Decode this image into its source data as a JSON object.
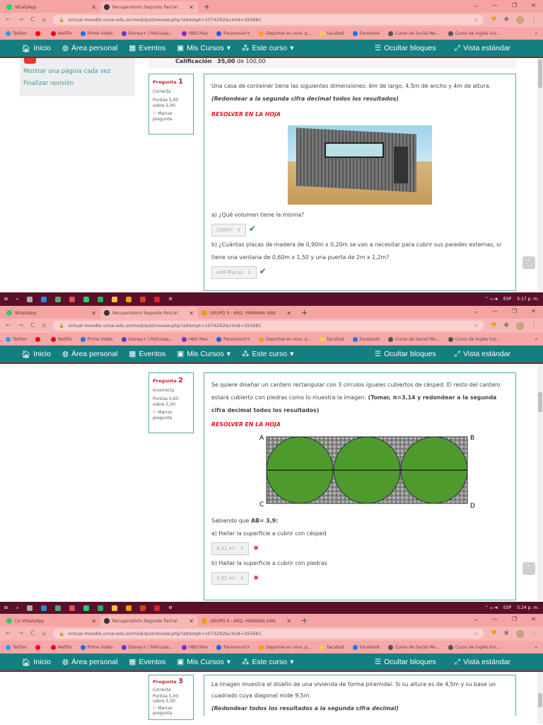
{
  "windows": [
    {
      "tabs": [
        {
          "label": "WhatsApp",
          "icon": "whatsapp-icon",
          "color": "#25d366"
        },
        {
          "label": "Recuperatorio Segundo Parcial",
          "icon": "moodle-icon",
          "color": "#333333"
        }
      ],
      "url": "virtual-moodle.unne.edu.ar/mod/quiz/review.php?attempt=1074292&cmid=355681"
    },
    {
      "tabs": [
        {
          "label": "WhatsApp",
          "icon": "whatsapp-icon",
          "color": "#25d366"
        },
        {
          "label": "Recuperatorio Segundo Parcial",
          "icon": "moodle-icon",
          "color": "#333333"
        },
        {
          "label": "GRUPO 9 - ARQ. MARIANA SÁN",
          "icon": "group-icon",
          "color": "#e0a020"
        }
      ],
      "url": "virtual-moodle.unne.edu.ar/mod/quiz/review.php?attempt=1074292&cmid=355681"
    },
    {
      "tabs": [
        {
          "label": "(1) WhatsApp",
          "icon": "whatsapp-icon",
          "color": "#25d366"
        },
        {
          "label": "Recuperatorio Segundo Parcial",
          "icon": "moodle-icon",
          "color": "#333333"
        },
        {
          "label": "GRUPO 9 - ARQ. MARIANA SÁN",
          "icon": "group-icon",
          "color": "#e0a020"
        }
      ],
      "url": "virtual-moodle.unne.edu.ar/mod/quiz/review.php?attempt=1074292&cmid=355681"
    }
  ],
  "bookmarks": [
    {
      "label": "Twitter",
      "color": "#1da1f2"
    },
    {
      "label": "",
      "color": "#ff0000"
    },
    {
      "label": "Netflix",
      "color": "#e50914"
    },
    {
      "label": "Prime Video",
      "color": "#1a73e8"
    },
    {
      "label": "Disney+ | Películas...",
      "color": "#5a3fd0"
    },
    {
      "label": "HBO Max",
      "color": "#7b2fd0"
    },
    {
      "label": "Paramount+",
      "color": "#0064ff"
    },
    {
      "label": "Deportes en vivo, p...",
      "color": "#ff9900"
    },
    {
      "label": "facultad",
      "color": "#f7d046"
    },
    {
      "label": "Facebook",
      "color": "#1877f2"
    },
    {
      "label": "Curso de Social Me...",
      "color": "#555555"
    },
    {
      "label": "Curso de Inglés Inic...",
      "color": "#555555"
    }
  ],
  "nav": {
    "inicio": "Inicio",
    "area": "Área personal",
    "eventos": "Eventos",
    "mis_cursos": "Mis Cursos",
    "este_curso": "Este curso",
    "ocultar": "Ocultar bloques",
    "vista": "Vista estándar"
  },
  "taskbar": [
    {
      "lang": "ESP",
      "time": "5:17 p. m."
    },
    {
      "lang": "ESP",
      "time": "5:24 p. m."
    }
  ],
  "sidebar": {
    "mostrar": "Mostrar una página cada vez",
    "finalizar": "Finalizar revisión"
  },
  "summary": {
    "label": "Calificación",
    "value": "35,00",
    "of": "de 100,00"
  },
  "questions": [
    {
      "title": "Pregunta",
      "number": "1",
      "status": "Correcta",
      "score": "Puntúa 5,00 sobre 5,00",
      "flag": "Marcar pregunta",
      "text": "Una casa de conteiner tiene las siguientes dimensiones: 6m de largo, 4,5m de ancho y 4m de altura.",
      "note": "(Redondear a la segunda cifra decimal todos los resultados)",
      "resolver": "RESOLVER EN LA HOJA",
      "parts": [
        {
          "q": "a) ¿Qué volumen tiene la misma?",
          "answer": "108m³",
          "correct": true
        },
        {
          "q": "b) ¿Cuántas placas de madera de 0,90m x 0,20m se van a necesitar para cubrir sus paredes externas, si tiene una  ventana  de 0,60m x 1,50 y una puerta de 2m x 1,2m?",
          "answer": "449 Placas",
          "correct": true
        }
      ]
    },
    {
      "title": "Pregunta",
      "number": "2",
      "status": "Incorrecta",
      "score": "Puntúa 0,00 sobre 5,00",
      "flag": "Marcar pregunta",
      "text": "Se quiere diseñar un cantero rectangular con 3  círculos iguales cubiertos de césped.  El resto del cantero estará cubierto con piedras como lo muestra la imagen.",
      "note": "(Tomar,  π=3,14  y redondear a la segunda cifra decimal todos los resultados)",
      "resolver": "RESOLVER EN LA HOJA",
      "diagram_labels": [
        "A",
        "B",
        "C",
        "D"
      ],
      "given_prefix": "Sabiendo que ",
      "given": "AB= 3,9:",
      "parts": [
        {
          "q": "a)  Hallar la superficie a cubrir con césped",
          "answer": "9,41 m²",
          "correct": false
        },
        {
          "q": "b) Hallar la superficie a cubrir con piedras",
          "answer": "2,95 m²",
          "correct": false
        }
      ]
    },
    {
      "title": "Pregunta",
      "number": "3",
      "status": "Correcta",
      "score": "Puntúa 5,00 sobre 5,00",
      "flag": "Marcar pregunta",
      "text": "La imagen muestra el diseño de una vivienda de forma piramidal.  Si su altura es de 4,5m y su base un cuadrado cuya diagonal mide 9,5m.",
      "note": "(Redondear todos los resultados a la segunda cifra decimal)"
    }
  ]
}
